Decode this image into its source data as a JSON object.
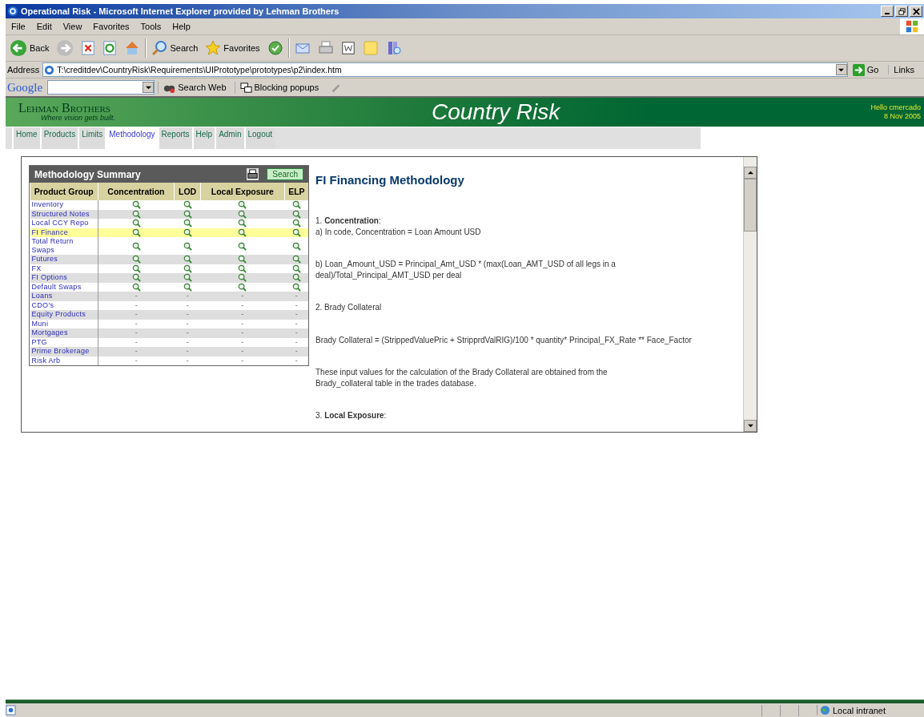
{
  "window": {
    "title": "Operational Risk - Microsoft Internet Explorer provided by Lehman Brothers"
  },
  "menu": [
    "File",
    "Edit",
    "View",
    "Favorites",
    "Tools",
    "Help"
  ],
  "toolbar": [
    {
      "kind": "back",
      "label": "Back"
    },
    {
      "kind": "forward"
    },
    {
      "kind": "stop"
    },
    {
      "kind": "refresh"
    },
    {
      "kind": "home"
    },
    {
      "kind": "search",
      "label": "Search"
    },
    {
      "kind": "favorites",
      "label": "Favorites"
    },
    {
      "kind": "media"
    },
    {
      "kind": "mail"
    },
    {
      "kind": "print"
    },
    {
      "kind": "word"
    },
    {
      "kind": "note"
    },
    {
      "kind": "research"
    }
  ],
  "address": {
    "label": "Address",
    "value": "T:\\creditdev\\CountryRisk\\Requirements\\UIPrototype\\prototypes\\p2\\index.htm",
    "go": "Go",
    "links": "Links"
  },
  "google_bar": {
    "logo": "Google",
    "search": "Search Web",
    "popups": "Blocking popups"
  },
  "header": {
    "brand": "Lehman Brothers",
    "tagline": "Where vision gets built.",
    "title": "Country Risk",
    "greeting": "Hello cmercado",
    "date": "8 Nov 2005"
  },
  "nav": [
    {
      "label": "Home",
      "selected": false
    },
    {
      "label": "Products",
      "selected": false
    },
    {
      "label": "Limits",
      "selected": false
    },
    {
      "label": "Methodology",
      "selected": true
    },
    {
      "label": "Reports",
      "selected": false
    },
    {
      "label": "Help",
      "selected": false
    },
    {
      "label": "Admin",
      "selected": false
    },
    {
      "label": "Logout",
      "selected": false
    }
  ],
  "summary": {
    "title": "Methodology Summary",
    "search": "Search",
    "columns": [
      "Product Group",
      "Concentration",
      "LOD",
      "Local Exposure",
      "ELP"
    ],
    "rows": [
      {
        "name": "Inventory",
        "selected": false,
        "kind": "icons"
      },
      {
        "name": "Structured Notes",
        "selected": false,
        "kind": "icons"
      },
      {
        "name": "Local CCY Repo",
        "selected": false,
        "kind": "icons"
      },
      {
        "name": "FI Finance",
        "selected": true,
        "kind": "icons"
      },
      {
        "name": "Total Return Swaps",
        "selected": false,
        "kind": "icons"
      },
      {
        "name": "Futures",
        "selected": false,
        "kind": "icons"
      },
      {
        "name": "FX",
        "selected": false,
        "kind": "icons"
      },
      {
        "name": "FI Options",
        "selected": false,
        "kind": "icons"
      },
      {
        "name": "Default Swaps",
        "selected": false,
        "kind": "icons"
      },
      {
        "name": "Loans",
        "selected": false,
        "kind": "text",
        "cells": [
          "-",
          "-",
          "-",
          "-"
        ]
      },
      {
        "name": "CDO's",
        "selected": false,
        "kind": "text",
        "cells": [
          "-",
          "-",
          "-",
          "-"
        ]
      },
      {
        "name": "Equity Products",
        "selected": false,
        "kind": "text",
        "cells": [
          "-",
          "-",
          "-",
          "-"
        ]
      },
      {
        "name": "Muni",
        "selected": false,
        "kind": "text",
        "cells": [
          "-",
          "-",
          "-",
          "-"
        ]
      },
      {
        "name": "Mortgages",
        "selected": false,
        "kind": "text",
        "cells": [
          "-",
          "-",
          "-",
          "-"
        ]
      },
      {
        "name": "PTG",
        "selected": false,
        "kind": "text",
        "cells": [
          "-",
          "-",
          "-",
          "-"
        ]
      },
      {
        "name": "Prime Brokerage",
        "selected": false,
        "kind": "text",
        "cells": [
          "-",
          "-",
          "-",
          "-"
        ]
      },
      {
        "name": "Risk Arb",
        "selected": false,
        "kind": "text",
        "cells": [
          "-",
          "-",
          "-",
          "-"
        ]
      }
    ]
  },
  "document": {
    "title": "FI Financing Methodology",
    "paragraphs": [
      [
        "1. **Concentration**:",
        "a) In code, Concentration = Loan Amount USD"
      ],
      [
        "b) Loan_Amount_USD = Principal_Amt_USD * (max(Loan_AMT_USD of all legs in a",
        "deal)/Total_Principal_AMT_USD per deal"
      ],
      [
        "2. Brady Collateral"
      ],
      [
        "Brady Collateral = (StrippedValuePric + StripprdValRIG)/100 * quantity* Principal_FX_Rate ** Face_Factor"
      ],
      [
        "These input values for the calculation of the Brady Collateral are obtained from the",
        "Brady_collateral table in the trades database."
      ],
      [
        "3. **Local Exposure**:"
      ]
    ]
  },
  "status_bar": {
    "zone": "Local intranet"
  }
}
